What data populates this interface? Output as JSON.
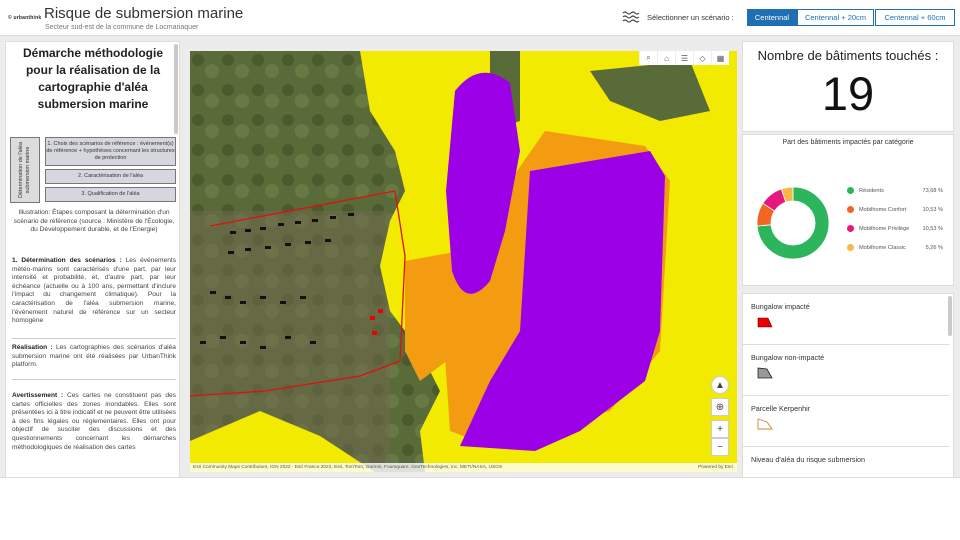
{
  "header": {
    "logo_text": "© urbanthink",
    "title": "Risque de submersion marine",
    "subtitle": "Secteur sud-est de la commune de Locmariaquer",
    "scenario_label": "Sélectionner un scénario :",
    "scenarios": [
      "Centennal",
      "Centennal + 20cm",
      "Centennal + 60cm"
    ],
    "selected_scenario": "Centennal"
  },
  "left_panel": {
    "title": "Démarche méthodologie pour la réalisation de la cartographie  d'aléa submersion marine",
    "diagram": {
      "vertical_label": "Détermination de l'aléa submersion marine",
      "steps": [
        "1. Choix des scénarios de référence : événement(s) de référence + hypothèses concernant les structures de protection",
        "2. Caractérisation de l'aléa",
        "3. Qualification de l'aléa"
      ]
    },
    "illustration": "Illustration: Étapes composant la détermination d'un scénario de référence (source : Ministère de l'Écologie, du Développement durable, et de l'Energie)",
    "p1_head": "1. Détermination des scénarios :",
    "p1_body": " Les événements météo-marins sont caractérisés d'une part, par leur intensité et probabilité, et, d'autre part, par leur échéance (actuelle ou à 100 ans, permettant d'inclure l'impact du changement climatique). Pour la caractérisation de l'aléa submersion marine, l'événement naturel de référence sur un secteur homogène",
    "p2_head": "Réalisation :",
    "p2_body": " Les cartographies des scénarios d'aléa submersion marine ont  été réalisées par UrbanThink platform.",
    "p3_head": "Avertissement :",
    "p3_body": " Ces cartes ne constituent pas des cartes officielles des zones inondables. Elles sont présentées ici à titre indicatif et ne peuvent être utilisées à des fins légales ou réglementaires. Elles ont pour objectif de susciter des discussions et des questionnements concernant les démarches méthodologiques de réalisation des cartes"
  },
  "map": {
    "attribution": "Esri Community Maps Contributors, IGN 2022 · Esri France 2022, Esri, TomTom, Garmin, Foursquare, GeoTechnologies, Inc, METI/NASA, USGS",
    "powered": "Powered by Esri",
    "toolbar_icons": [
      "search-icon",
      "home-icon",
      "list-icon",
      "layers-icon",
      "grid-icon"
    ],
    "zoom_in": "+",
    "zoom_out": "−"
  },
  "counter": {
    "title": "Nombre de bâtiments touchés :",
    "value": "19"
  },
  "pie": {
    "title": "Part des bâtiments impactés par catégorie",
    "chart_data": {
      "type": "pie",
      "categories": [
        "Résidents",
        "Mobilhome Confort",
        "Mobilhome Privilège",
        "Mobilhome Classic"
      ],
      "values": [
        73.68,
        10.53,
        10.53,
        5.26
      ],
      "colors": [
        "#2db55d",
        "#f26522",
        "#e6177d",
        "#f7b849"
      ],
      "labels": [
        "73,68 %",
        "10,53 %",
        "10,53 %",
        "5,26 %"
      ]
    }
  },
  "legend": {
    "items": [
      {
        "label": "Bungalow impacté",
        "symbol": "red-polygon"
      },
      {
        "label": "Bungalow non-impacté",
        "symbol": "grey-polygon"
      },
      {
        "label": "Parcelle Kerpenhir",
        "symbol": "orange-outline-polygon"
      },
      {
        "label": "Niveau d'aléa du risque submersion",
        "symbol": "hazard"
      }
    ]
  }
}
